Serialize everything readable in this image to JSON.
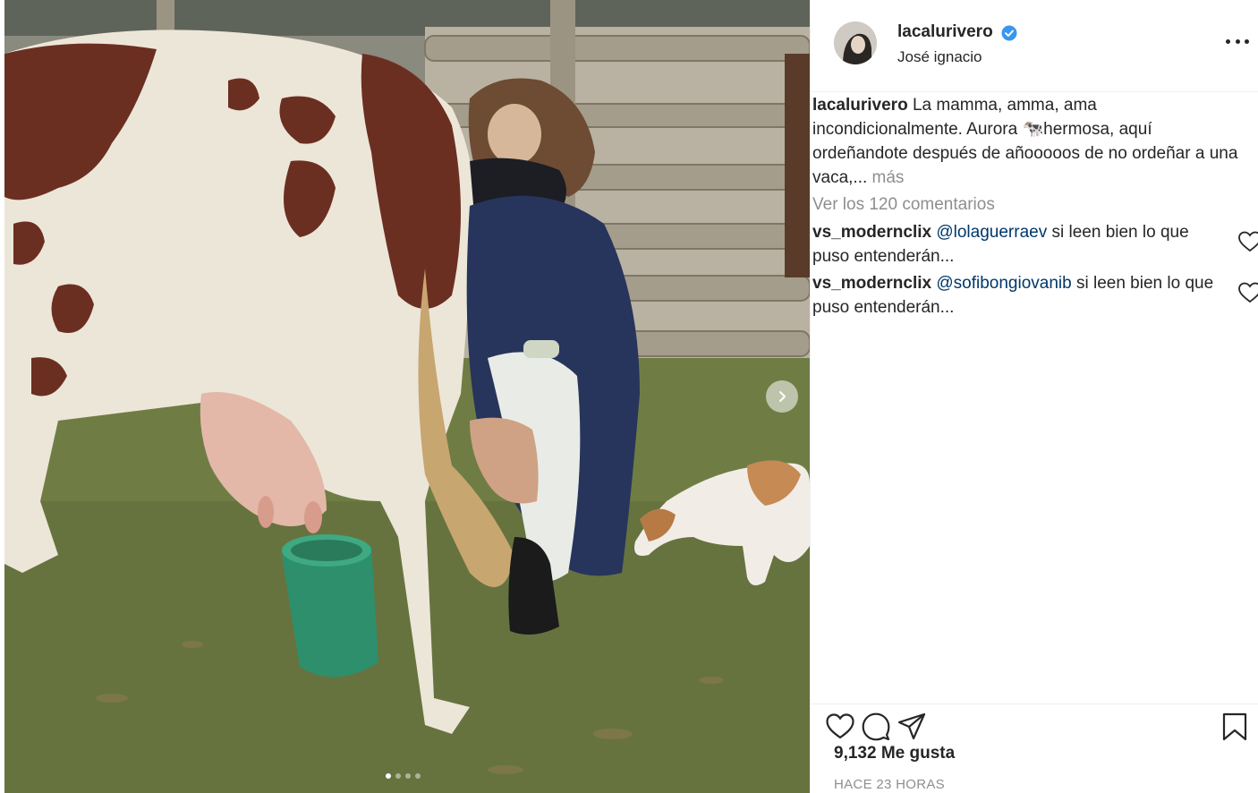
{
  "post": {
    "username": "lacalurivero",
    "location": "José ignacio",
    "verified": true
  },
  "caption": {
    "username": "lacalurivero",
    "text": "La mamma, amma, ama incondicionalmente. Aurora 🐄hermosa, aquí ordeñandote después de añooooos de no ordeñar a una vaca,...",
    "more_label": "más"
  },
  "view_all_comments": "Ver los 120 comentarios",
  "comments": [
    {
      "username": "vs_modernclix",
      "mention": "@lolaguerraev",
      "text": "si leen bien lo que puso entenderán..."
    },
    {
      "username": "vs_modernclix",
      "mention": "@sofibongiovanib",
      "text": "si leen bien lo que puso entenderán..."
    }
  ],
  "likes_text": "9,132 Me gusta",
  "timestamp": "HACE 23 HORAS",
  "carousel": {
    "total": 4,
    "active": 1
  },
  "colors": {
    "mention": "#00376b",
    "muted": "#8e8e8e",
    "verified": "#3897f0"
  },
  "icons": [
    "heart-icon",
    "comment-icon",
    "share-icon",
    "bookmark-icon",
    "verified-icon",
    "more-icon",
    "chevron-right-icon"
  ]
}
